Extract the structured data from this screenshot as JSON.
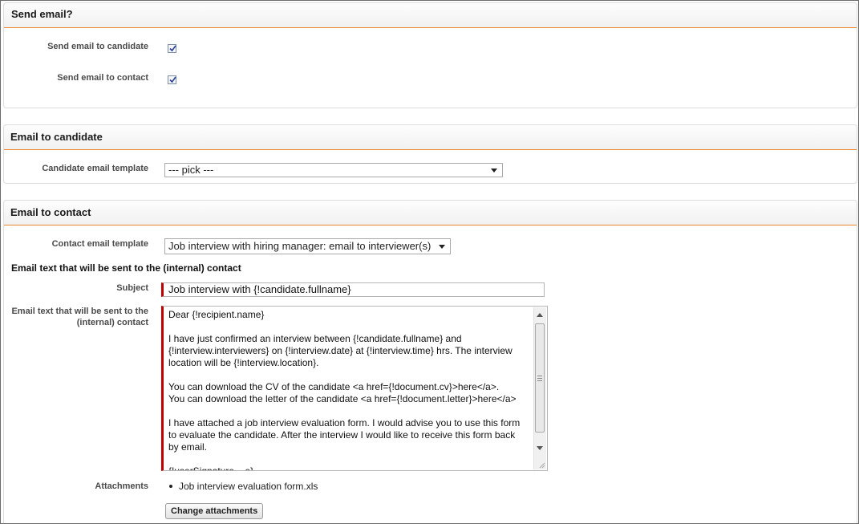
{
  "send_email_section": {
    "title": "Send email?",
    "send_to_candidate_label": "Send email to candidate",
    "send_to_candidate_checked": true,
    "send_to_contact_label": "Send email to contact",
    "send_to_contact_checked": true
  },
  "candidate_section": {
    "title": "Email to candidate",
    "template_label": "Candidate email template",
    "template_value": "--- pick ---"
  },
  "contact_section": {
    "title": "Email to contact",
    "template_label": "Contact email template",
    "template_value": "Job interview with hiring manager: email to interviewer(s)",
    "email_text_heading": "Email text that will be sent to the (internal) contact",
    "subject_label": "Subject",
    "subject_value": "Job interview with {!candidate.fullname}",
    "body_label": "Email text that will be sent to the (internal) contact",
    "body_value": "Dear {!recipient.name}\n\nI have just confirmed an interview between {!candidate.fullname} and\n{!interview.interviewers} on {!interview.date} at {!interview.time} hrs. The interview\nlocation will be {!interview.location}.\n\nYou can download the CV of the candidate <a href={!document.cv}>here</a>.\nYou can download the letter of the candidate <a href={!document.letter}>here</a>\n\nI have attached a job interview evaluation form. I would advise you to use this form\nto evaluate the candidate. After the interview I would like to receive this form back\nby email.\n\n{!userSignature....e}",
    "attachments_label": "Attachments",
    "attachments": [
      "Job interview evaluation form.xls"
    ],
    "change_attachments_label": "Change attachments"
  }
}
